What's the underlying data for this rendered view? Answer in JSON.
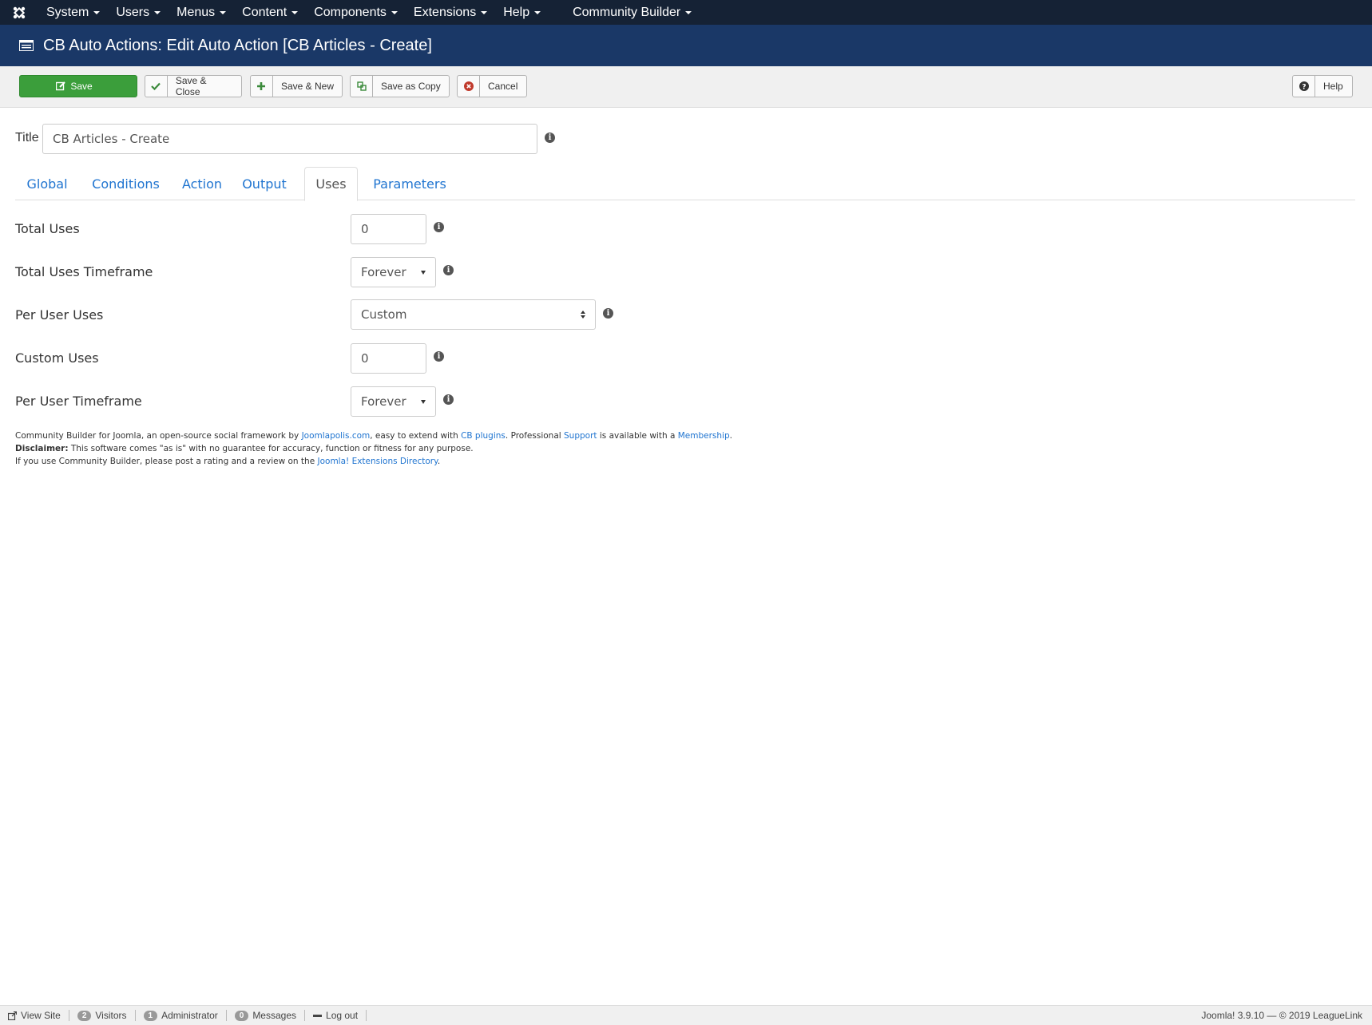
{
  "navbar": {
    "items": [
      {
        "label": "System"
      },
      {
        "label": "Users"
      },
      {
        "label": "Menus"
      },
      {
        "label": "Content"
      },
      {
        "label": "Components"
      },
      {
        "label": "Extensions"
      },
      {
        "label": "Help"
      },
      {
        "label": "Community Builder"
      }
    ]
  },
  "header": {
    "title": "CB Auto Actions: Edit Auto Action [CB Articles - Create]"
  },
  "toolbar": {
    "save_label": "Save",
    "save_close_label": "Save & Close",
    "save_new_label": "Save & New",
    "save_copy_label": "Save as Copy",
    "cancel_label": "Cancel",
    "help_label": "Help"
  },
  "form": {
    "title_label": "Title",
    "title_value": "CB Articles - Create"
  },
  "tabs": [
    {
      "label": "Global"
    },
    {
      "label": "Conditions"
    },
    {
      "label": "Action"
    },
    {
      "label": "Output"
    },
    {
      "label": "Uses",
      "active": true
    },
    {
      "label": "Parameters"
    }
  ],
  "fields": {
    "total_uses": {
      "label": "Total Uses",
      "value": "0"
    },
    "total_uses_timeframe": {
      "label": "Total Uses Timeframe",
      "value": "Forever"
    },
    "per_user_uses": {
      "label": "Per User Uses",
      "value": "Custom"
    },
    "custom_uses": {
      "label": "Custom Uses",
      "value": "0"
    },
    "per_user_timeframe": {
      "label": "Per User Timeframe",
      "value": "Forever"
    }
  },
  "footer": {
    "line1_a": "Community Builder for Joomla, an open-source social framework by ",
    "link_joomlapolis": "Joomlapolis.com",
    "line1_b": ", easy to extend with ",
    "link_cb_plugins": "CB plugins",
    "line1_c": ". Professional ",
    "link_support": "Support",
    "line1_d": " is available with a ",
    "link_membership": "Membership",
    "line1_e": ".",
    "disclaimer_label": "Disclaimer:",
    "disclaimer_text": " This software comes \"as is\" with no guarantee for accuracy, function or fitness for any purpose.",
    "line3_a": "If you use Community Builder, please post a rating and a review on the ",
    "link_jed": "Joomla! Extensions Directory",
    "line3_b": "."
  },
  "statusbar": {
    "view_site": "View Site",
    "visitors_count": "2",
    "visitors_label": "Visitors",
    "admin_count": "1",
    "admin_label": "Administrator",
    "messages_count": "0",
    "messages_label": "Messages",
    "logout": "Log out",
    "version": "Joomla! 3.9.10 — © 2019 LeagueLink"
  },
  "colors": {
    "navbar": "#152235",
    "subhead": "#1a3867",
    "save_button": "#3b9e3b",
    "link": "#1f74d0"
  }
}
